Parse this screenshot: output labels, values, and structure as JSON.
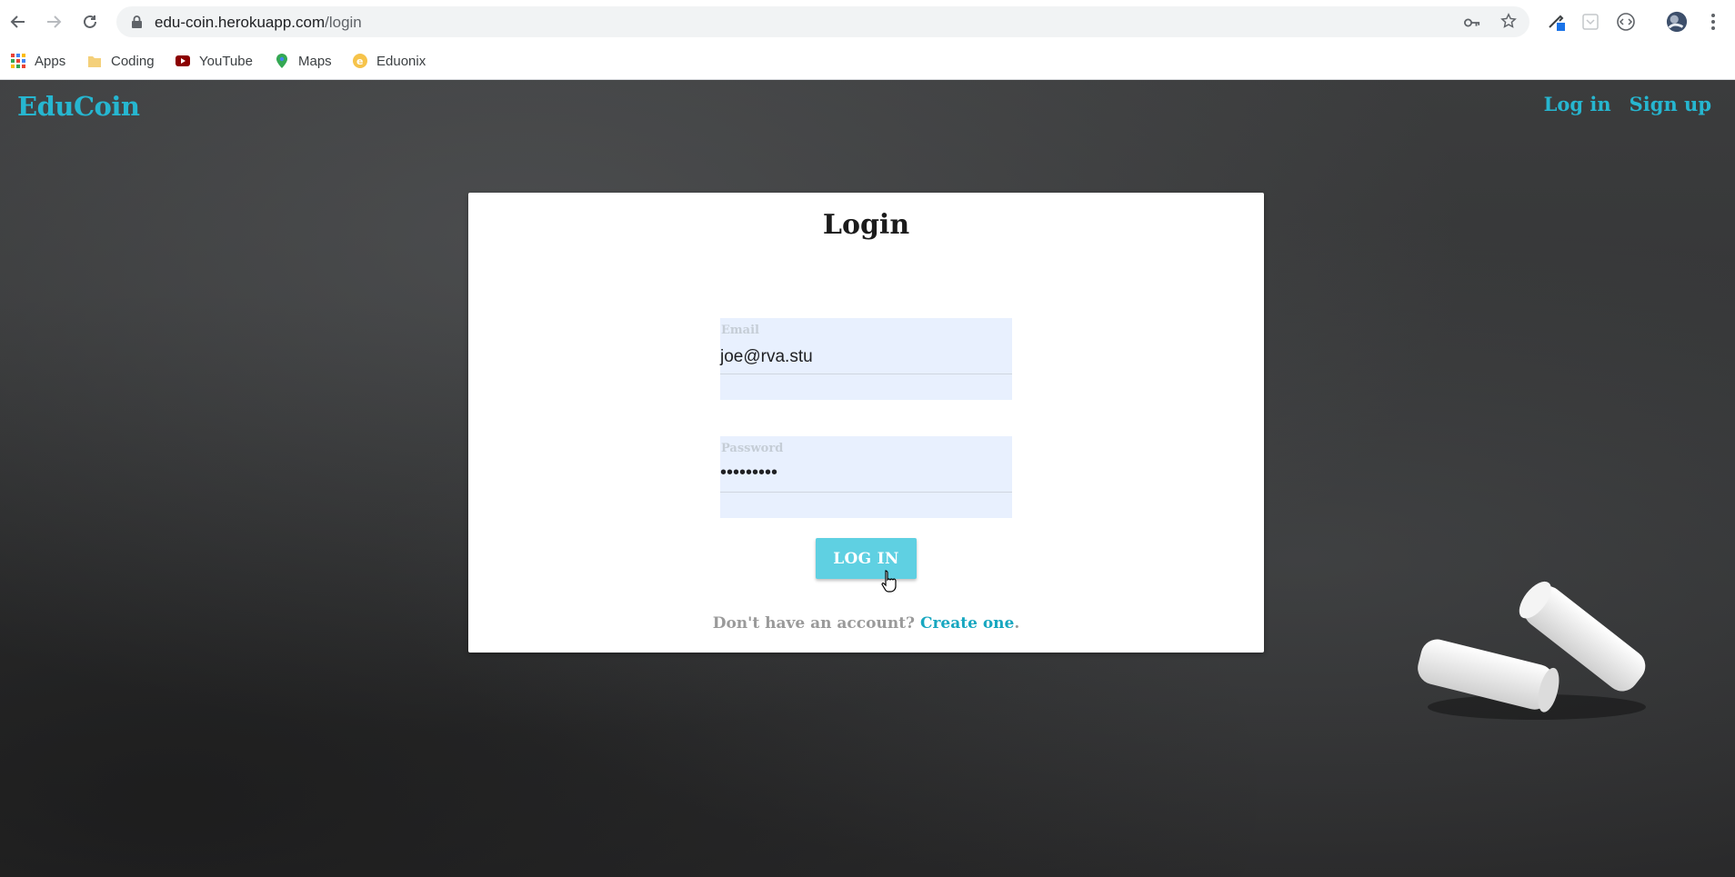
{
  "browser": {
    "url_host": "edu-coin.herokuapp.com",
    "url_path": "/login",
    "bookmarks": [
      {
        "label": "Apps",
        "icon": "apps-grid-icon"
      },
      {
        "label": "Coding",
        "icon": "folder-icon"
      },
      {
        "label": "YouTube",
        "icon": "youtube-icon"
      },
      {
        "label": "Maps",
        "icon": "maps-pin-icon"
      },
      {
        "label": "Eduonix",
        "icon": "eduonix-icon"
      }
    ]
  },
  "site": {
    "brand": "EduCoin",
    "nav": {
      "login": "Log in",
      "signup": "Sign up"
    },
    "accent_color": "#26b6d0"
  },
  "login_form": {
    "title": "Login",
    "email": {
      "label": "Email",
      "value": "joe@rva.stu"
    },
    "password": {
      "label": "Password",
      "value": "•••••••••"
    },
    "submit_label": "LOG IN",
    "signup_prompt": "Don't have an account?",
    "signup_link": "Create one",
    "signup_suffix": "."
  }
}
